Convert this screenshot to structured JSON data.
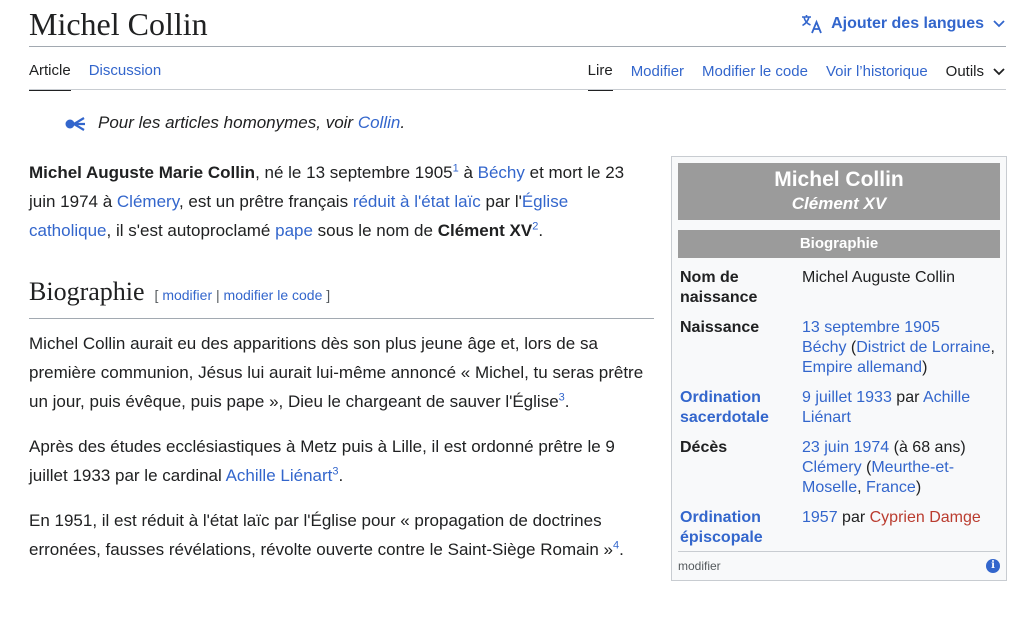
{
  "page": {
    "title": "Michel Collin"
  },
  "header": {
    "languages_label": "Ajouter des langues"
  },
  "tabs": {
    "article": "Article",
    "discussion": "Discussion",
    "read": "Lire",
    "edit": "Modifier",
    "edit_source": "Modifier le code",
    "history": "Voir l’historique",
    "tools": "Outils"
  },
  "hatnote": {
    "text": "Pour les articles homonymes, voir ",
    "link": "Collin",
    "end": "."
  },
  "intro": {
    "name": "Michel Auguste Marie Collin",
    "t1": ", né le 13 septembre 1905",
    "ref1": "1",
    "t2": " à ",
    "link_bechy": "Béchy",
    "t3": " et mort le 23 juin 1974 à ",
    "link_clemery": "Clémery",
    "t4": ", est un prêtre français ",
    "link_reduit": "réduit à l'état laïc",
    "t5": " par l'",
    "link_eglise": "Église catholique",
    "t6": ", il s'est autoproclamé ",
    "link_pape": "pape",
    "t7": " sous le nom de ",
    "pope_name": "Clément XV",
    "ref2": "2",
    "t8": "."
  },
  "section": {
    "title": "Biographie",
    "edit_open": "[ ",
    "edit": "modifier",
    "sep": " | ",
    "edit_source": "modifier le code",
    "edit_close": " ]"
  },
  "paragraphs": {
    "p1_text": "Michel Collin aurait eu des apparitions dès son plus jeune âge et, lors de sa première communion, Jésus lui aurait lui-même annoncé « Michel, tu seras prêtre un jour, puis évêque, puis pape », Dieu le chargeant de sauver l'Église",
    "p1_ref": "3",
    "p1_end": ".",
    "p2_text": "Après des études ecclésiastiques à Metz puis à Lille, il est ordonné prêtre le 9 juillet 1933 par le cardinal ",
    "p2_link": "Achille Liénart",
    "p2_ref": "3",
    "p2_end": ".",
    "p3_text": "En 1951, il est réduit à l'état laïc par l'Église pour « propagation de doctrines erronées, fausses révélations, révolte ouverte contre le Saint-Siège Romain »",
    "p3_ref": "4",
    "p3_end": "."
  },
  "infobox": {
    "name": "Michel Collin",
    "subtitle": "Clément XV",
    "section": "Biographie",
    "birth_name_label": "Nom de naissance",
    "birth_name": "Michel Auguste Collin",
    "birth_label": "Naissance",
    "birth_date": "13 septembre 1905",
    "birth_place": "Béchy",
    "birth_district": "District de Lorraine",
    "birth_empire": "Empire allemand",
    "ordination_label": "Ordination sacerdotale",
    "ordination_date": "9 juillet 1933",
    "ordination_by": " par ",
    "ordination_person": "Achille Liénart",
    "death_label": "Décès",
    "death_date": "23 juin 1974",
    "death_age": " (à 68 ans)",
    "death_place": "Clémery",
    "death_region": "Meurthe-et-Moselle",
    "death_country": "France",
    "episcopal_label": "Ordination épiscopale",
    "episcopal_year": "1957",
    "episcopal_by": " par ",
    "episcopal_person": "Cyprien Damge",
    "footer_edit": "modifier"
  },
  "colors": {
    "link": "#3366cc",
    "redlink": "#ba3c2f",
    "infobox_header": "#9b9b9b"
  }
}
